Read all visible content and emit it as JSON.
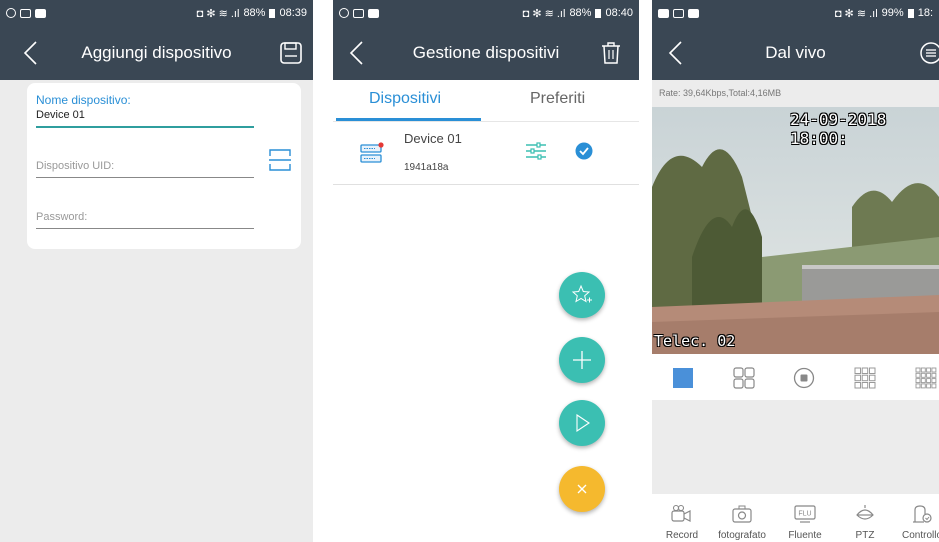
{
  "colors": {
    "appbar": "#3a4754",
    "accent_blue": "#2a8fd6",
    "teal": "#3bbfb2",
    "orange": "#f5b92e",
    "background": "#ececec"
  },
  "screen1": {
    "status": {
      "battery": "88%",
      "time": "08:39"
    },
    "title": "Aggiungi dispositivo",
    "back_icon": "chevron-left-icon",
    "save_icon": "floppy-disk-icon",
    "scan_icon": "qr-scan-icon",
    "form": {
      "name_label": "Nome dispositivo:",
      "name_value": "Device 01",
      "uid_placeholder": "Dispositivo UID:",
      "password_placeholder": "Password:"
    }
  },
  "screen2": {
    "status": {
      "battery": "88%",
      "time": "08:40"
    },
    "title": "Gestione dispositivi",
    "delete_icon": "trash-icon",
    "tabs": [
      "Dispositivi",
      "Preferiti"
    ],
    "device": {
      "name": "Device 01",
      "uid": "1941a18a"
    },
    "fabs": [
      "star-add-icon",
      "plus-icon",
      "play-icon",
      "close-icon"
    ]
  },
  "screen3": {
    "status": {
      "battery": "99%",
      "time": "18:"
    },
    "title": "Dal vivo",
    "menu_icon": "menu-icon",
    "rate": "Rate: 39,64Kbps,Total:4,16MB",
    "osd_timestamp": "24-09-2018 18:00:",
    "osd_camera": "Telec. 02",
    "view_icons": [
      "single-view-icon",
      "quad-view-icon",
      "stop-icon",
      "nine-view-icon",
      "sixteen-view-icon"
    ],
    "bottom": [
      {
        "label": "Record",
        "icon": "video-record-icon"
      },
      {
        "label": "fotografato",
        "icon": "camera-icon"
      },
      {
        "label": "Fluente",
        "icon": "stream-quality-icon"
      },
      {
        "label": "PTZ",
        "icon": "ptz-icon"
      },
      {
        "label": "Controllo",
        "icon": "control-icon"
      }
    ]
  }
}
